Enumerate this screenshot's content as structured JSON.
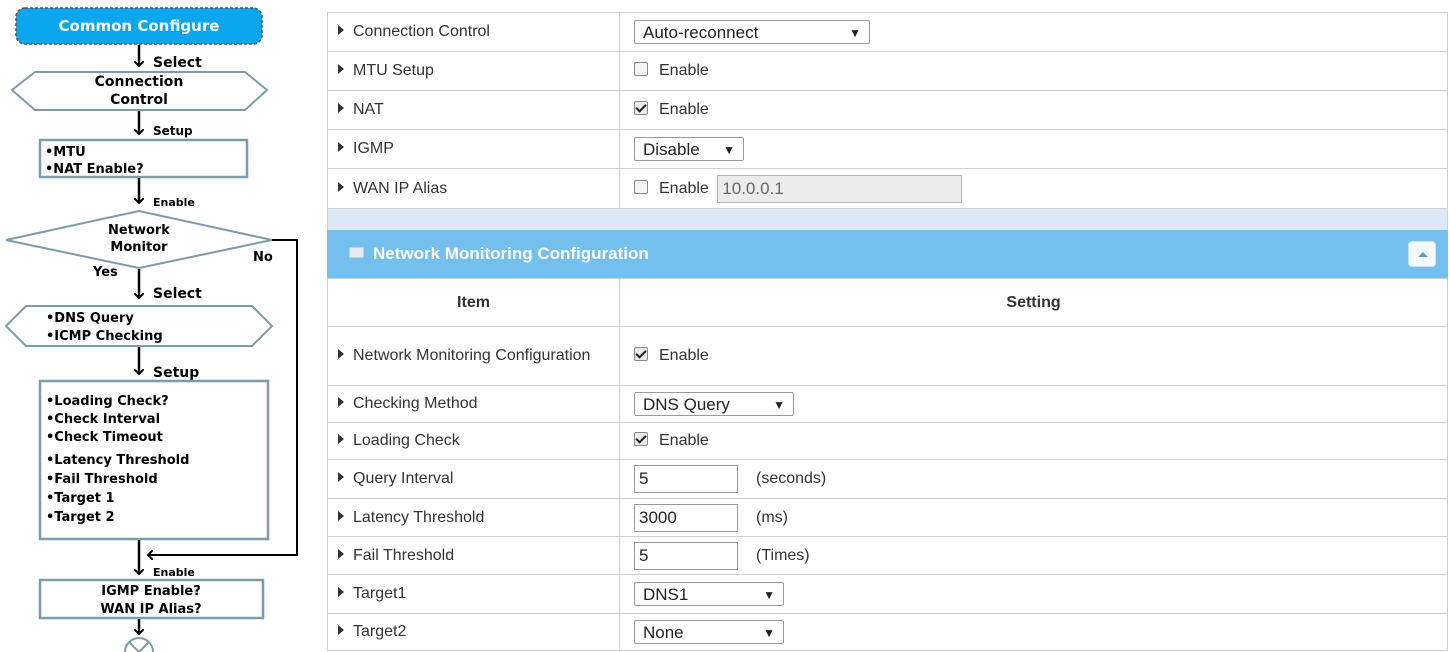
{
  "flowchart": {
    "start": "Common Configure",
    "select1": "Select",
    "connection_control": [
      "Connection",
      "Control"
    ],
    "setup1": "Setup",
    "setup_box": [
      "•MTU",
      "•NAT Enable?"
    ],
    "enable1": "Enable",
    "network_monitor": [
      "Network",
      "Monitor"
    ],
    "no": "No",
    "yes": "Yes",
    "select2": "Select",
    "method_box": [
      "•DNS Query",
      "•ICMP Checking"
    ],
    "setup2": "Setup",
    "params_box": [
      "•Loading Check?",
      "•Check Interval",
      "•Check Timeout",
      "•Latency Threshold",
      "•Fail Threshold",
      "•Target 1",
      "•Target 2"
    ],
    "enable2": "Enable",
    "end_box": [
      "IGMP Enable?",
      "WAN  IP Alias?"
    ]
  },
  "wan_config": {
    "connection_control": {
      "label": "Connection Control",
      "value": "Auto-reconnect"
    },
    "mtu_setup": {
      "label": "MTU Setup",
      "checkbox_label": "Enable",
      "checked": false
    },
    "nat": {
      "label": "NAT",
      "checkbox_label": "Enable",
      "checked": true
    },
    "igmp": {
      "label": "IGMP",
      "value": "Disable"
    },
    "wan_ip_alias": {
      "label": "WAN IP Alias",
      "checkbox_label": "Enable",
      "checked": false,
      "value": "10.0.0.1"
    }
  },
  "network_monitoring": {
    "title": "Network Monitoring Configuration",
    "header": {
      "item": "Item",
      "setting": "Setting"
    },
    "enable": {
      "label": "Network Monitoring Configuration",
      "checkbox_label": "Enable",
      "checked": true
    },
    "checking_method": {
      "label": "Checking Method",
      "value": "DNS Query"
    },
    "loading_check": {
      "label": "Loading Check",
      "checkbox_label": "Enable",
      "checked": true
    },
    "query_interval": {
      "label": "Query Interval",
      "value": "5",
      "unit": "(seconds)"
    },
    "latency_threshold": {
      "label": "Latency Threshold",
      "value": "3000",
      "unit": "(ms)"
    },
    "fail_threshold": {
      "label": "Fail Threshold",
      "value": "5",
      "unit": "(Times)"
    },
    "target1": {
      "label": "Target1",
      "value": "DNS1"
    },
    "target2": {
      "label": "Target2",
      "value": "None"
    }
  },
  "colors": {
    "start_box": "#0aa7ef",
    "section_header": "#73bfee",
    "flow_border": "#7f9ba8"
  }
}
